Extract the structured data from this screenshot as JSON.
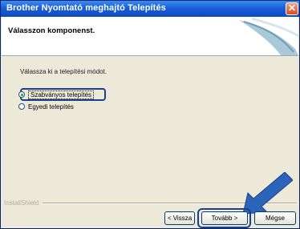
{
  "window": {
    "title": "Brother Nyomtató meghajtó Telepítés",
    "close_glyph": "✕"
  },
  "header": {
    "title": "Válasszon komponenst."
  },
  "body": {
    "instruction": "Válassza ki a telepítési módot.",
    "options": [
      {
        "label": "Szabványos telepítés",
        "checked": true
      },
      {
        "label": "Egyedi telepítés",
        "checked": false
      }
    ]
  },
  "footer": {
    "brand": "InstallShield",
    "back_label": "< Vissza",
    "next_label": "Tovább >",
    "cancel_label": "Mégse"
  },
  "colors": {
    "title_bar": "#1a5fd8",
    "highlight": "#1d3f8a",
    "arrow": "#2b64b8"
  }
}
